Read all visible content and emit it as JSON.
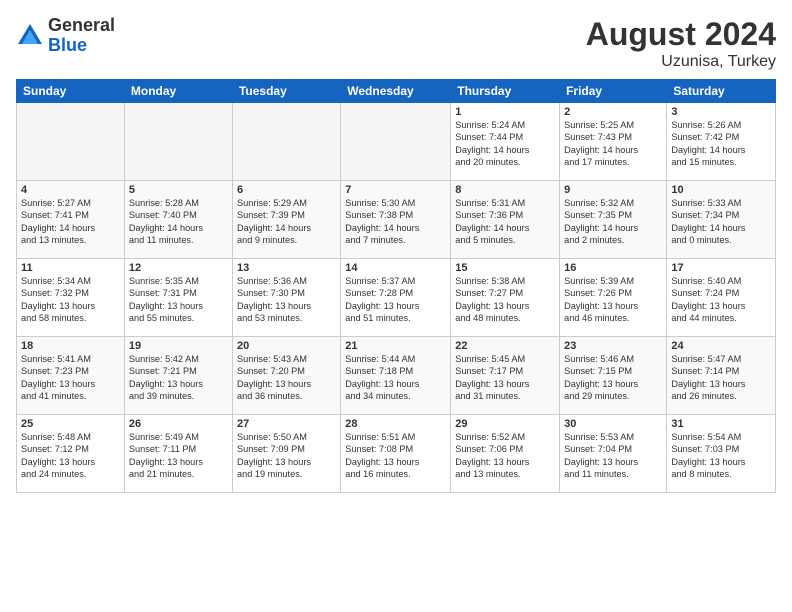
{
  "logo": {
    "general": "General",
    "blue": "Blue"
  },
  "title": "August 2024",
  "location": "Uzunisa, Turkey",
  "days_header": [
    "Sunday",
    "Monday",
    "Tuesday",
    "Wednesday",
    "Thursday",
    "Friday",
    "Saturday"
  ],
  "weeks": [
    [
      {
        "num": "",
        "info": ""
      },
      {
        "num": "",
        "info": ""
      },
      {
        "num": "",
        "info": ""
      },
      {
        "num": "",
        "info": ""
      },
      {
        "num": "1",
        "info": "Sunrise: 5:24 AM\nSunset: 7:44 PM\nDaylight: 14 hours\nand 20 minutes."
      },
      {
        "num": "2",
        "info": "Sunrise: 5:25 AM\nSunset: 7:43 PM\nDaylight: 14 hours\nand 17 minutes."
      },
      {
        "num": "3",
        "info": "Sunrise: 5:26 AM\nSunset: 7:42 PM\nDaylight: 14 hours\nand 15 minutes."
      }
    ],
    [
      {
        "num": "4",
        "info": "Sunrise: 5:27 AM\nSunset: 7:41 PM\nDaylight: 14 hours\nand 13 minutes."
      },
      {
        "num": "5",
        "info": "Sunrise: 5:28 AM\nSunset: 7:40 PM\nDaylight: 14 hours\nand 11 minutes."
      },
      {
        "num": "6",
        "info": "Sunrise: 5:29 AM\nSunset: 7:39 PM\nDaylight: 14 hours\nand 9 minutes."
      },
      {
        "num": "7",
        "info": "Sunrise: 5:30 AM\nSunset: 7:38 PM\nDaylight: 14 hours\nand 7 minutes."
      },
      {
        "num": "8",
        "info": "Sunrise: 5:31 AM\nSunset: 7:36 PM\nDaylight: 14 hours\nand 5 minutes."
      },
      {
        "num": "9",
        "info": "Sunrise: 5:32 AM\nSunset: 7:35 PM\nDaylight: 14 hours\nand 2 minutes."
      },
      {
        "num": "10",
        "info": "Sunrise: 5:33 AM\nSunset: 7:34 PM\nDaylight: 14 hours\nand 0 minutes."
      }
    ],
    [
      {
        "num": "11",
        "info": "Sunrise: 5:34 AM\nSunset: 7:32 PM\nDaylight: 13 hours\nand 58 minutes."
      },
      {
        "num": "12",
        "info": "Sunrise: 5:35 AM\nSunset: 7:31 PM\nDaylight: 13 hours\nand 55 minutes."
      },
      {
        "num": "13",
        "info": "Sunrise: 5:36 AM\nSunset: 7:30 PM\nDaylight: 13 hours\nand 53 minutes."
      },
      {
        "num": "14",
        "info": "Sunrise: 5:37 AM\nSunset: 7:28 PM\nDaylight: 13 hours\nand 51 minutes."
      },
      {
        "num": "15",
        "info": "Sunrise: 5:38 AM\nSunset: 7:27 PM\nDaylight: 13 hours\nand 48 minutes."
      },
      {
        "num": "16",
        "info": "Sunrise: 5:39 AM\nSunset: 7:26 PM\nDaylight: 13 hours\nand 46 minutes."
      },
      {
        "num": "17",
        "info": "Sunrise: 5:40 AM\nSunset: 7:24 PM\nDaylight: 13 hours\nand 44 minutes."
      }
    ],
    [
      {
        "num": "18",
        "info": "Sunrise: 5:41 AM\nSunset: 7:23 PM\nDaylight: 13 hours\nand 41 minutes."
      },
      {
        "num": "19",
        "info": "Sunrise: 5:42 AM\nSunset: 7:21 PM\nDaylight: 13 hours\nand 39 minutes."
      },
      {
        "num": "20",
        "info": "Sunrise: 5:43 AM\nSunset: 7:20 PM\nDaylight: 13 hours\nand 36 minutes."
      },
      {
        "num": "21",
        "info": "Sunrise: 5:44 AM\nSunset: 7:18 PM\nDaylight: 13 hours\nand 34 minutes."
      },
      {
        "num": "22",
        "info": "Sunrise: 5:45 AM\nSunset: 7:17 PM\nDaylight: 13 hours\nand 31 minutes."
      },
      {
        "num": "23",
        "info": "Sunrise: 5:46 AM\nSunset: 7:15 PM\nDaylight: 13 hours\nand 29 minutes."
      },
      {
        "num": "24",
        "info": "Sunrise: 5:47 AM\nSunset: 7:14 PM\nDaylight: 13 hours\nand 26 minutes."
      }
    ],
    [
      {
        "num": "25",
        "info": "Sunrise: 5:48 AM\nSunset: 7:12 PM\nDaylight: 13 hours\nand 24 minutes."
      },
      {
        "num": "26",
        "info": "Sunrise: 5:49 AM\nSunset: 7:11 PM\nDaylight: 13 hours\nand 21 minutes."
      },
      {
        "num": "27",
        "info": "Sunrise: 5:50 AM\nSunset: 7:09 PM\nDaylight: 13 hours\nand 19 minutes."
      },
      {
        "num": "28",
        "info": "Sunrise: 5:51 AM\nSunset: 7:08 PM\nDaylight: 13 hours\nand 16 minutes."
      },
      {
        "num": "29",
        "info": "Sunrise: 5:52 AM\nSunset: 7:06 PM\nDaylight: 13 hours\nand 13 minutes."
      },
      {
        "num": "30",
        "info": "Sunrise: 5:53 AM\nSunset: 7:04 PM\nDaylight: 13 hours\nand 11 minutes."
      },
      {
        "num": "31",
        "info": "Sunrise: 5:54 AM\nSunset: 7:03 PM\nDaylight: 13 hours\nand 8 minutes."
      }
    ]
  ]
}
